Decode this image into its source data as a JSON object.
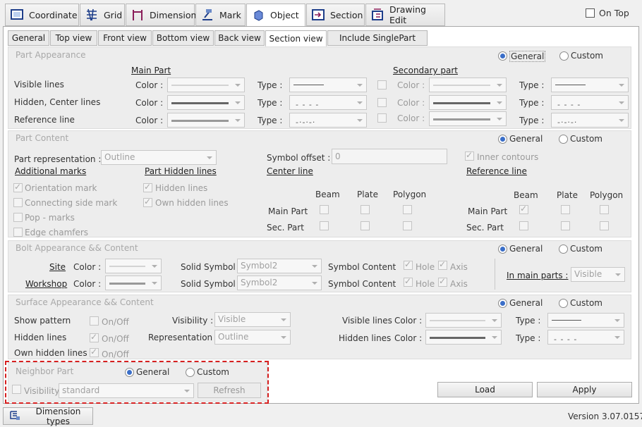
{
  "main_tabs": [
    "Coordinate",
    "Grid",
    "Dimension",
    "Mark",
    "Object",
    "Section",
    "Drawing Edit"
  ],
  "on_top": "On Top",
  "sub_tabs": [
    "General",
    "Top view",
    "Front view",
    "Bottom view",
    "Back view",
    "Section view",
    "Include SinglePart"
  ],
  "radio": {
    "general": "General",
    "custom": "Custom"
  },
  "part_appearance": {
    "title": "Part Appearance",
    "main_part": "Main Part",
    "secondary_part": "Secondary part",
    "rows": [
      "Visible lines",
      "Hidden, Center lines",
      "Reference line"
    ],
    "color": "Color :",
    "type": "Type :"
  },
  "part_content": {
    "title": "Part Content",
    "part_representation": "Part representation :",
    "rep_value": "Outline",
    "symbol_offset": "Symbol offset :",
    "offset_value": "0",
    "inner_contours": "Inner contours",
    "additional_marks": "Additional marks",
    "part_hidden_lines": "Part Hidden lines",
    "center_line": "Center line",
    "reference_line": "Reference line",
    "marks": [
      "Orientation mark",
      "Connecting side mark",
      "Pop - marks",
      "Edge chamfers"
    ],
    "hidden": [
      "Hidden lines",
      "Own hidden lines"
    ],
    "cols": [
      "Beam",
      "Plate",
      "Polygon"
    ],
    "rows": [
      "Main Part",
      "Sec. Part"
    ]
  },
  "bolt": {
    "title": "Bolt Appearance && Content",
    "site": "Site",
    "workshop": "Workshop",
    "color": "Color :",
    "solid_symbol": "Solid Symbol :",
    "symbol_value": "Symbol2",
    "symbol_content": "Symbol Content",
    "hole": "Hole",
    "axis": "Axis",
    "in_main_parts": "In main parts :",
    "visible": "Visible"
  },
  "surface": {
    "title": "Surface Appearance && Content",
    "show_pattern": "Show pattern",
    "hidden_lines": "Hidden lines",
    "own_hidden_lines": "Own hidden lines",
    "on_off": "On/Off",
    "visibility": "Visibility :",
    "visibility_value": "Visible",
    "representation": "Representation",
    "rep_value": "Outline",
    "visible_lines": "Visible lines",
    "color": "Color :",
    "type": "Type :"
  },
  "neighbor": {
    "title": "Neighbor Part",
    "visibility": "Visibility",
    "value": "standard",
    "refresh": "Refresh"
  },
  "buttons": {
    "load": "Load",
    "apply": "Apply"
  },
  "footer": {
    "dimension_types": "Dimension types",
    "version": "Version 3.07.0157"
  }
}
